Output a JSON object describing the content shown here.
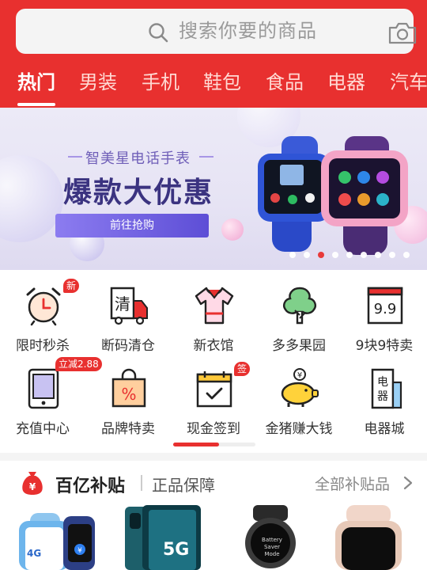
{
  "search": {
    "placeholder": "搜索你要的商品",
    "icon": "search-icon",
    "camera_icon": "camera-icon"
  },
  "tabs": [
    {
      "label": "热门",
      "active": true
    },
    {
      "label": "男装"
    },
    {
      "label": "手机"
    },
    {
      "label": "鞋包"
    },
    {
      "label": "食品"
    },
    {
      "label": "电器"
    },
    {
      "label": "汽车"
    }
  ],
  "banner": {
    "subtitle": "智美星电话手表",
    "title": "爆款大优惠",
    "button": "前往抢购",
    "slide_count": 9,
    "active_slide": 3
  },
  "categories": [
    {
      "label": "限时秒杀",
      "icon": "alarm-clock-icon",
      "badge": "新"
    },
    {
      "label": "断码清仓",
      "icon": "clearance-truck-icon"
    },
    {
      "label": "新衣馆",
      "icon": "shirt-icon"
    },
    {
      "label": "多多果园",
      "icon": "tree-icon"
    },
    {
      "label": "9块9特卖",
      "icon": "calendar-99-icon"
    },
    {
      "label": "充值中心",
      "icon": "phone-recharge-icon",
      "badge": "立减2.88"
    },
    {
      "label": "品牌特卖",
      "icon": "shopping-bag-percent-icon"
    },
    {
      "label": "现金签到",
      "icon": "calendar-check-icon",
      "badge": "签"
    },
    {
      "label": "金猪赚大钱",
      "icon": "gold-pig-icon"
    },
    {
      "label": "电器城",
      "icon": "appliance-icon"
    }
  ],
  "grid_scroll_progress": 0.56,
  "subsidy": {
    "title": "百亿补贴",
    "guarantee": "正品保障",
    "all_link": "全部补贴品",
    "products": [
      {
        "name": "kids-smartwatch",
        "text": "4G"
      },
      {
        "name": "huawei-phone",
        "text": "5G"
      },
      {
        "name": "sports-watch",
        "text": "Battery Saver Mode"
      },
      {
        "name": "apple-watch",
        "text": ""
      }
    ]
  },
  "colors": {
    "brand_red": "#e8302f",
    "banner_purple": "#5d4ed6"
  }
}
